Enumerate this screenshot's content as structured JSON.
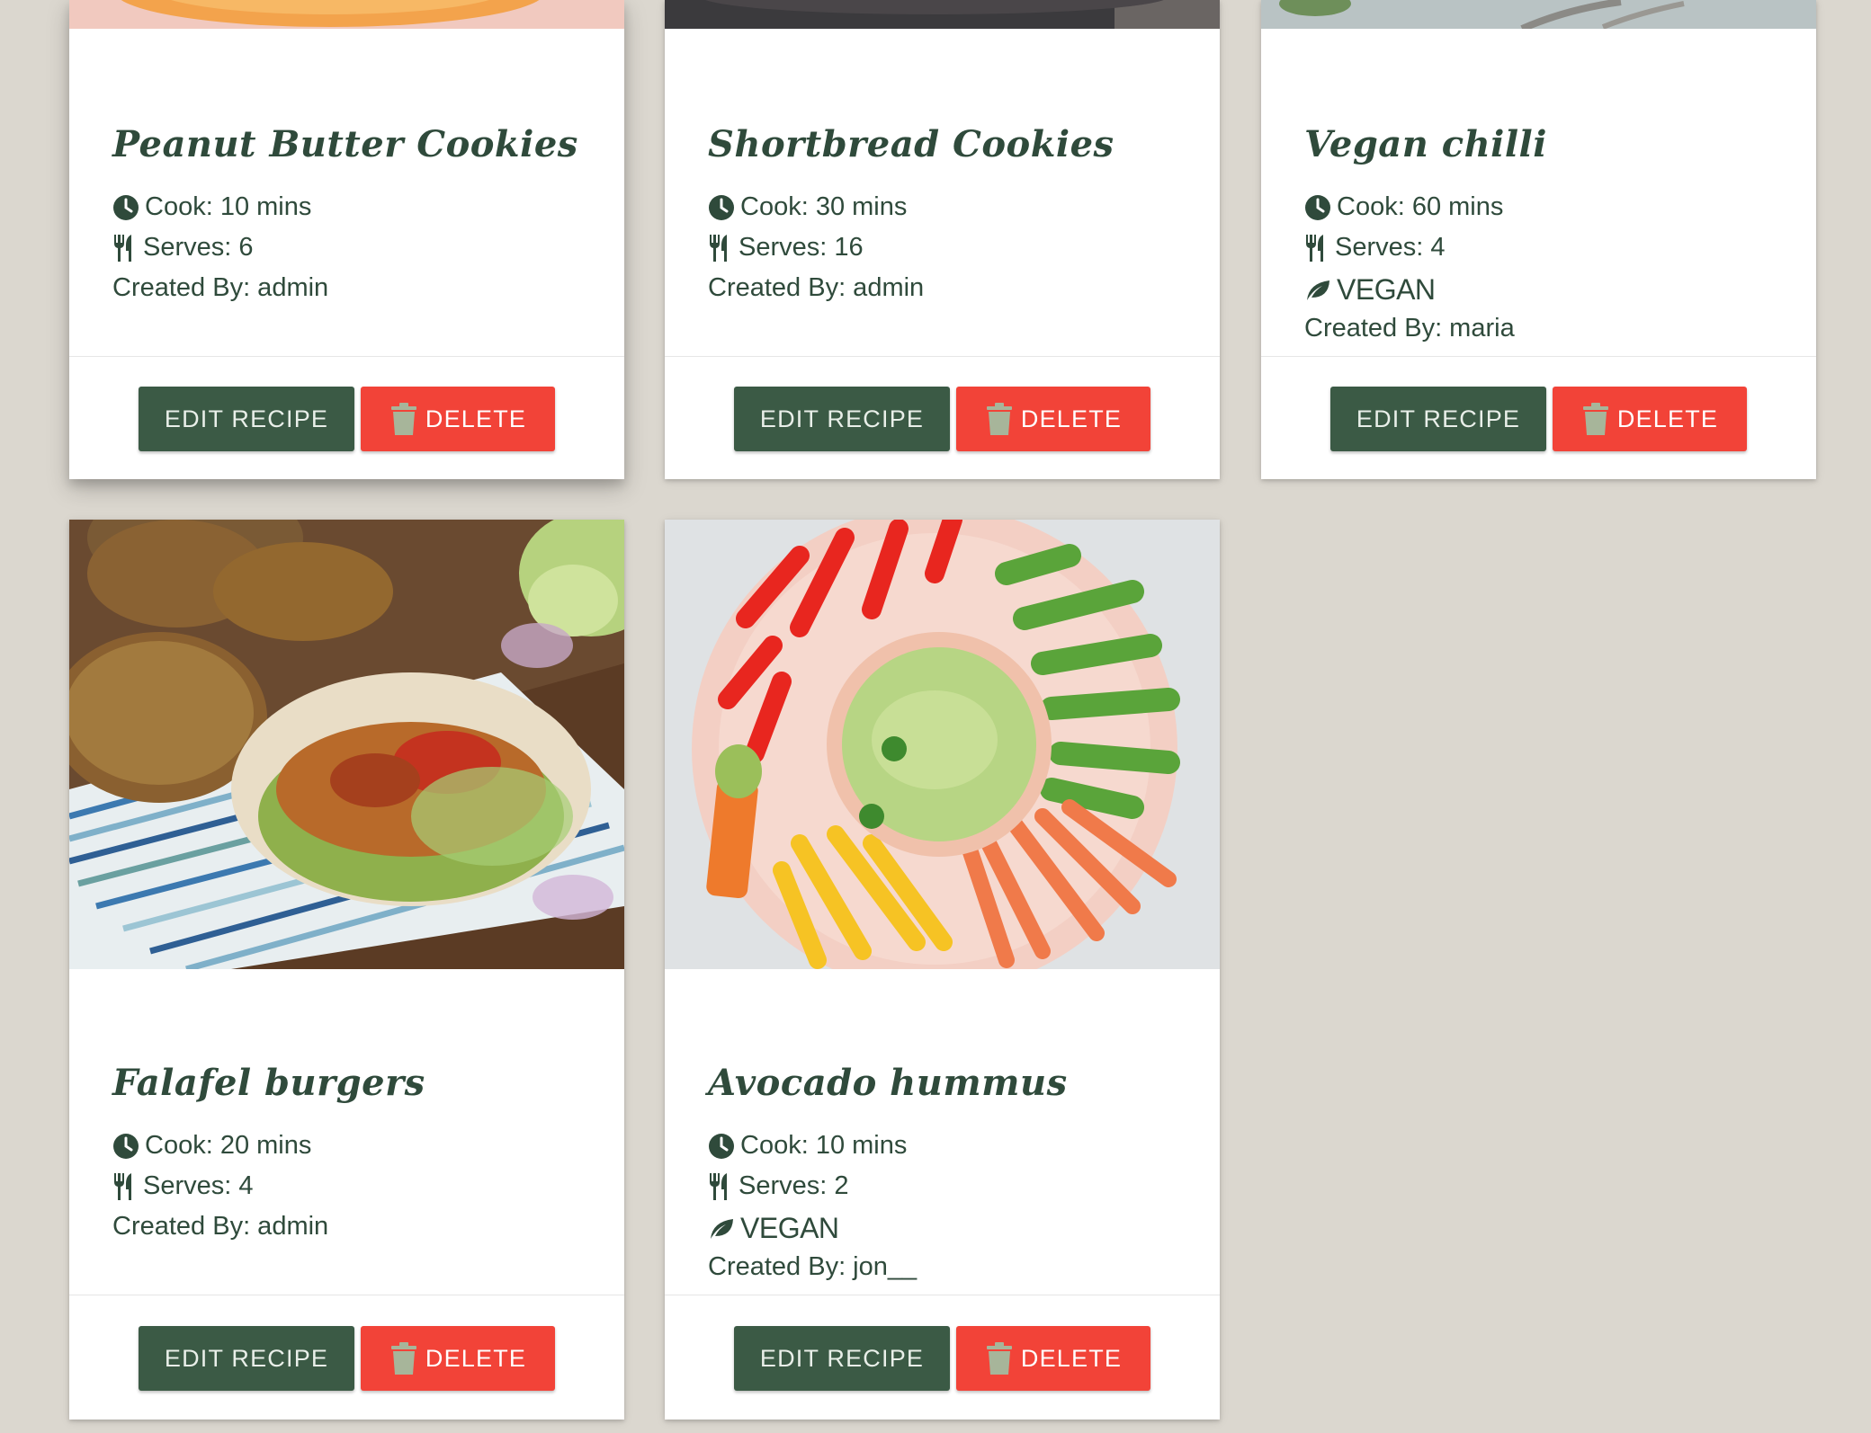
{
  "recipes": [
    {
      "title": "Peanut Butter Cookies",
      "cook": "Cook: 10 mins",
      "serves": "Serves: 6",
      "vegan": "",
      "created_by": "Created By: admin",
      "edit_label": "EDIT RECIPE",
      "delete_label": "DELETE"
    },
    {
      "title": "Shortbread Cookies",
      "cook": "Cook: 30 mins",
      "serves": "Serves: 16",
      "vegan": "",
      "created_by": "Created By: admin",
      "edit_label": "EDIT RECIPE",
      "delete_label": "DELETE"
    },
    {
      "title": "Vegan chilli",
      "cook": "Cook: 60 mins",
      "serves": "Serves: 4",
      "vegan": "VEGAN",
      "created_by": "Created By: maria",
      "edit_label": "EDIT RECIPE",
      "delete_label": "DELETE"
    },
    {
      "title": "Falafel burgers",
      "cook": "Cook: 20 mins",
      "serves": "Serves: 4",
      "vegan": "",
      "created_by": "Created By: admin",
      "edit_label": "EDIT RECIPE",
      "delete_label": "DELETE"
    },
    {
      "title": "Avocado hummus",
      "cook": "Cook: 10 mins",
      "serves": "Serves: 2",
      "vegan": "VEGAN",
      "created_by": "Created By: jon__",
      "edit_label": "EDIT RECIPE",
      "delete_label": "DELETE"
    }
  ],
  "icons": {
    "cook": "clock-icon",
    "serves": "utensils-icon",
    "vegan": "leaf-icon",
    "delete": "trash-icon"
  },
  "colors": {
    "background": "#dbd7cf",
    "text": "#2f4a3b",
    "edit_button": "#3b5a45",
    "delete_button": "#f24338",
    "trash_icon": "#a7b59a"
  }
}
